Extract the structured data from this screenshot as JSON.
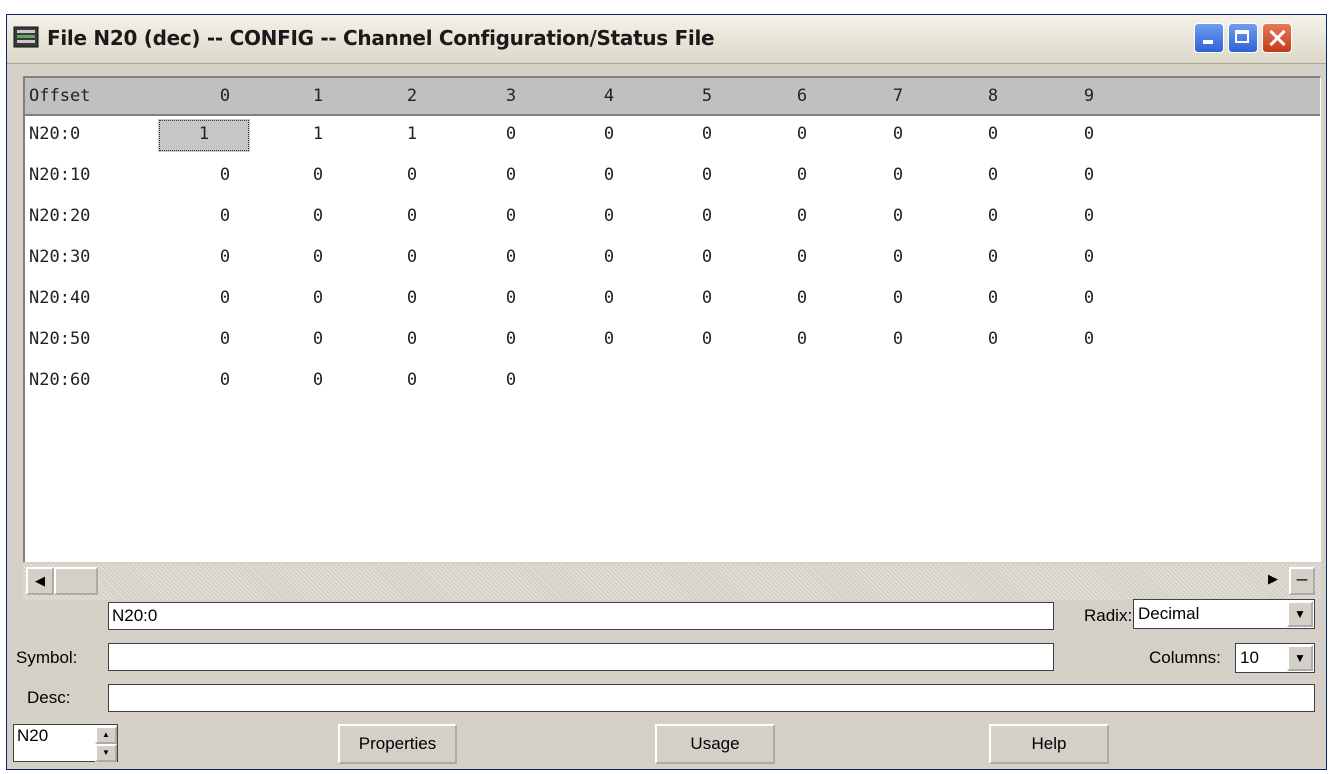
{
  "window": {
    "title": "File N20 (dec)  --  CONFIG  --  Channel Configuration/Status File"
  },
  "grid": {
    "columns": [
      "Offset",
      "0",
      "1",
      "2",
      "3",
      "4",
      "5",
      "6",
      "7",
      "8",
      "9"
    ],
    "rows": [
      {
        "offset": "N20:0",
        "values": [
          "1",
          "1",
          "1",
          "0",
          "0",
          "0",
          "0",
          "0",
          "0",
          "0"
        ]
      },
      {
        "offset": "N20:10",
        "values": [
          "0",
          "0",
          "0",
          "0",
          "0",
          "0",
          "0",
          "0",
          "0",
          "0"
        ]
      },
      {
        "offset": "N20:20",
        "values": [
          "0",
          "0",
          "0",
          "0",
          "0",
          "0",
          "0",
          "0",
          "0",
          "0"
        ]
      },
      {
        "offset": "N20:30",
        "values": [
          "0",
          "0",
          "0",
          "0",
          "0",
          "0",
          "0",
          "0",
          "0",
          "0"
        ]
      },
      {
        "offset": "N20:40",
        "values": [
          "0",
          "0",
          "0",
          "0",
          "0",
          "0",
          "0",
          "0",
          "0",
          "0"
        ]
      },
      {
        "offset": "N20:50",
        "values": [
          "0",
          "0",
          "0",
          "0",
          "0",
          "0",
          "0",
          "0",
          "0",
          "0"
        ]
      },
      {
        "offset": "N20:60",
        "values": [
          "0",
          "0",
          "0",
          "0"
        ]
      }
    ],
    "selected_cell": "N20:0"
  },
  "form": {
    "address_value": "N20:0",
    "radix_label": "Radix:",
    "radix_value": "Decimal",
    "symbol_label": "Symbol:",
    "symbol_value": "",
    "columns_label": "Columns:",
    "columns_value": "10",
    "desc_label": "Desc:",
    "desc_value": "",
    "file_value": "N20"
  },
  "buttons": {
    "properties": "Properties",
    "usage": "Usage",
    "help": "Help"
  },
  "icons": {
    "title": "file-icon",
    "scroll_left": "arrow-left-icon",
    "scroll_right": "arrow-right-icon",
    "split": "minus-icon",
    "dropdown": "chevron-down-icon",
    "spin_up": "arrow-up-icon",
    "spin_down": "arrow-down-icon"
  }
}
